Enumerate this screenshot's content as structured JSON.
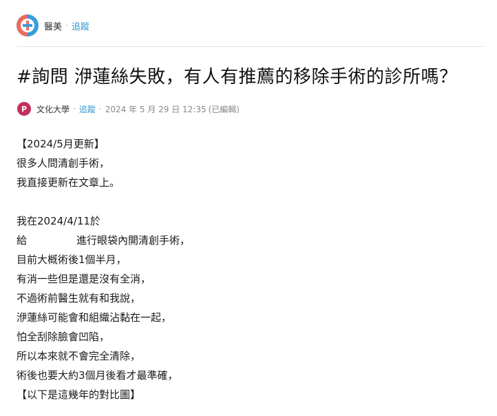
{
  "forum": {
    "name": "醫美",
    "separator": "·",
    "follow_label": "追蹤"
  },
  "post": {
    "title": "#詢問 洢蓮絲失敗，有人有推薦的移除手術的診所嗎？",
    "author": {
      "avatar_letter": "P",
      "name": "文化大學",
      "follow_label": "追蹤",
      "timestamp": "2024 年 5 月 29 日 12:35",
      "edited": "(已編輯)"
    },
    "body": [
      "【2024/5月更新】",
      "很多人問清創手術，",
      "我直接更新在文章上。",
      "",
      "我在2024/4/11於",
      "進行眼袋內開清創手術，",
      "目前大概術後1個半月，",
      "有消一些但是還是沒有全消，",
      "不過術前醫生就有和我說，",
      "洢蓮絲可能會和組織沾黏在一起，",
      "怕全刮除臉會凹陷，",
      "所以本來就不會完全清除，",
      "術後也要大約3個月後看才最準確，",
      "【以下是這幾年的對比圖】"
    ],
    "body_line6_prefix": "給"
  },
  "colors": {
    "link": "#3397cf",
    "logo_red": "#ee6a5f",
    "logo_blue": "#3a9bd9",
    "avatar": "#c2305e"
  }
}
